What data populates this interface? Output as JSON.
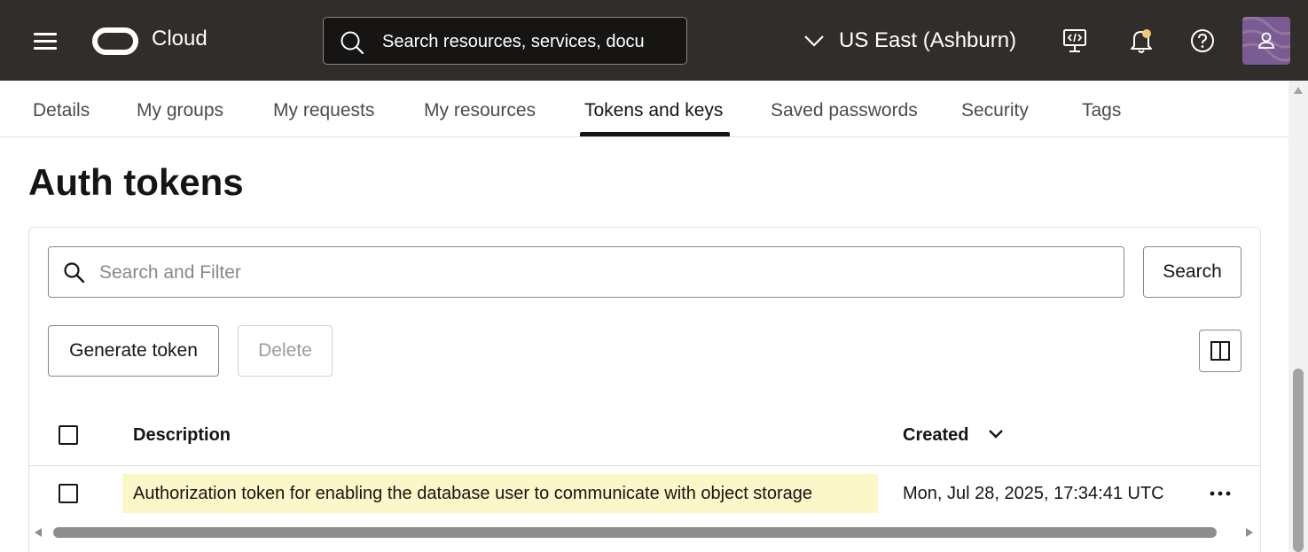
{
  "header": {
    "brand": "Cloud",
    "search_placeholder": "Search resources, services, docu",
    "region": "US East (Ashburn)"
  },
  "tabs": [
    {
      "label": "Details"
    },
    {
      "label": "My groups"
    },
    {
      "label": "My requests"
    },
    {
      "label": "My resources"
    },
    {
      "label": "Tokens and keys",
      "active": true
    },
    {
      "label": "Saved passwords"
    },
    {
      "label": "Security"
    },
    {
      "label": "Tags"
    }
  ],
  "page": {
    "title": "Auth tokens"
  },
  "toolbar": {
    "filter_placeholder": "Search and Filter",
    "search_label": "Search",
    "generate_label": "Generate token",
    "delete_label": "Delete"
  },
  "table": {
    "columns": [
      "Description",
      "Created"
    ],
    "rows": [
      {
        "description": "Authorization token for enabling the database user to communicate with object storage",
        "created": "Mon, Jul 28, 2025, 17:34:41 UTC"
      }
    ]
  },
  "colors": {
    "header_bg": "#312d2a",
    "highlight": "#fcf7c8",
    "avatar": "#7b5b94"
  }
}
